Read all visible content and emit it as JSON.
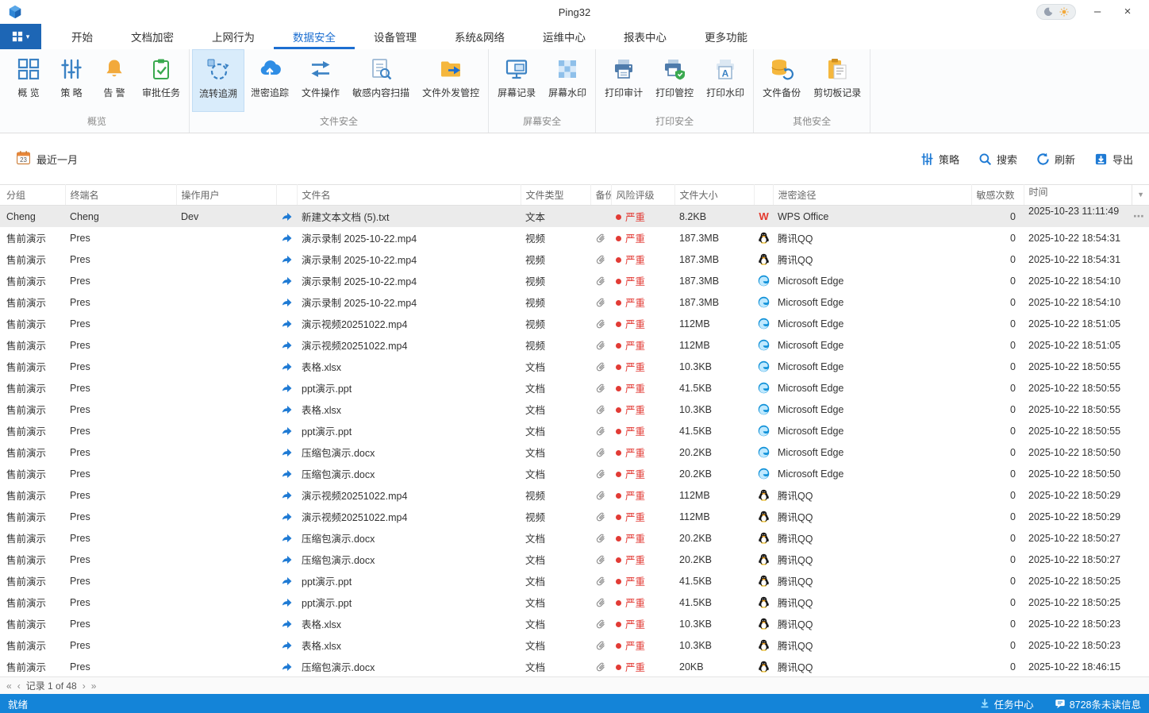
{
  "window": {
    "title": "Ping32",
    "controls": {
      "minimize": "–",
      "close": "×"
    }
  },
  "ribbon": {
    "tabs": [
      {
        "label": "开始"
      },
      {
        "label": "文档加密"
      },
      {
        "label": "上网行为"
      },
      {
        "label": "数据安全",
        "active": true
      },
      {
        "label": "设备管理"
      },
      {
        "label": "系统&网络"
      },
      {
        "label": "运维中心"
      },
      {
        "label": "报表中心"
      },
      {
        "label": "更多功能"
      }
    ],
    "groups": [
      {
        "label": "概览",
        "buttons": [
          {
            "label": "概 览"
          },
          {
            "label": "策 略"
          },
          {
            "label": "告 警"
          },
          {
            "label": "审批任务"
          }
        ]
      },
      {
        "label": "文件安全",
        "buttons": [
          {
            "label": "流转追溯",
            "selected": true
          },
          {
            "label": "泄密追踪"
          },
          {
            "label": "文件操作"
          },
          {
            "label": "敏感内容扫描"
          },
          {
            "label": "文件外发管控"
          }
        ]
      },
      {
        "label": "屏幕安全",
        "buttons": [
          {
            "label": "屏幕记录"
          },
          {
            "label": "屏幕水印"
          }
        ]
      },
      {
        "label": "打印安全",
        "buttons": [
          {
            "label": "打印审计"
          },
          {
            "label": "打印管控"
          },
          {
            "label": "打印水印"
          }
        ]
      },
      {
        "label": "其他安全",
        "buttons": [
          {
            "label": "文件备份"
          },
          {
            "label": "剪切板记录"
          }
        ]
      }
    ]
  },
  "toolbar": {
    "date_filter": "最近一月",
    "calendar_day": "23",
    "actions": [
      {
        "label": "策略"
      },
      {
        "label": "搜索"
      },
      {
        "label": "刷新"
      },
      {
        "label": "导出"
      }
    ]
  },
  "table": {
    "columns": [
      "分组",
      "终端名",
      "操作用户",
      "",
      "文件名",
      "文件类型",
      "备份",
      "风险评级",
      "文件大小",
      "",
      "泄密途径",
      "敏感次数",
      "时间"
    ],
    "rows": [
      {
        "group": "Cheng",
        "terminal": "Cheng",
        "user": "Dev",
        "file": "新建文本文档 (5).txt",
        "type": "文本",
        "attach": false,
        "risk": "严重",
        "size": "8.2KB",
        "channel": "WPS Office",
        "channel_icon": "wps",
        "count": "0",
        "time": "2025-10-23 11:11:49",
        "selected": true
      },
      {
        "group": "售前演示",
        "terminal": "Pres",
        "user": "",
        "file": "演示录制 2025-10-22.mp4",
        "type": "视频",
        "attach": true,
        "risk": "严重",
        "size": "187.3MB",
        "channel": "腾讯QQ",
        "channel_icon": "qq",
        "count": "0",
        "time": "2025-10-22 18:54:31"
      },
      {
        "group": "售前演示",
        "terminal": "Pres",
        "user": "",
        "file": "演示录制 2025-10-22.mp4",
        "type": "视频",
        "attach": true,
        "risk": "严重",
        "size": "187.3MB",
        "channel": "腾讯QQ",
        "channel_icon": "qq",
        "count": "0",
        "time": "2025-10-22 18:54:31"
      },
      {
        "group": "售前演示",
        "terminal": "Pres",
        "user": "",
        "file": "演示录制 2025-10-22.mp4",
        "type": "视频",
        "attach": true,
        "risk": "严重",
        "size": "187.3MB",
        "channel": "Microsoft Edge",
        "channel_icon": "edge",
        "count": "0",
        "time": "2025-10-22 18:54:10"
      },
      {
        "group": "售前演示",
        "terminal": "Pres",
        "user": "",
        "file": "演示录制 2025-10-22.mp4",
        "type": "视频",
        "attach": true,
        "risk": "严重",
        "size": "187.3MB",
        "channel": "Microsoft Edge",
        "channel_icon": "edge",
        "count": "0",
        "time": "2025-10-22 18:54:10"
      },
      {
        "group": "售前演示",
        "terminal": "Pres",
        "user": "",
        "file": "演示视频20251022.mp4",
        "type": "视频",
        "attach": true,
        "risk": "严重",
        "size": "112MB",
        "channel": "Microsoft Edge",
        "channel_icon": "edge",
        "count": "0",
        "time": "2025-10-22 18:51:05"
      },
      {
        "group": "售前演示",
        "terminal": "Pres",
        "user": "",
        "file": "演示视频20251022.mp4",
        "type": "视频",
        "attach": true,
        "risk": "严重",
        "size": "112MB",
        "channel": "Microsoft Edge",
        "channel_icon": "edge",
        "count": "0",
        "time": "2025-10-22 18:51:05"
      },
      {
        "group": "售前演示",
        "terminal": "Pres",
        "user": "",
        "file": "表格.xlsx",
        "type": "文档",
        "attach": true,
        "risk": "严重",
        "size": "10.3KB",
        "channel": "Microsoft Edge",
        "channel_icon": "edge",
        "count": "0",
        "time": "2025-10-22 18:50:55"
      },
      {
        "group": "售前演示",
        "terminal": "Pres",
        "user": "",
        "file": "ppt演示.ppt",
        "type": "文档",
        "attach": true,
        "risk": "严重",
        "size": "41.5KB",
        "channel": "Microsoft Edge",
        "channel_icon": "edge",
        "count": "0",
        "time": "2025-10-22 18:50:55"
      },
      {
        "group": "售前演示",
        "terminal": "Pres",
        "user": "",
        "file": "表格.xlsx",
        "type": "文档",
        "attach": true,
        "risk": "严重",
        "size": "10.3KB",
        "channel": "Microsoft Edge",
        "channel_icon": "edge",
        "count": "0",
        "time": "2025-10-22 18:50:55"
      },
      {
        "group": "售前演示",
        "terminal": "Pres",
        "user": "",
        "file": "ppt演示.ppt",
        "type": "文档",
        "attach": true,
        "risk": "严重",
        "size": "41.5KB",
        "channel": "Microsoft Edge",
        "channel_icon": "edge",
        "count": "0",
        "time": "2025-10-22 18:50:55"
      },
      {
        "group": "售前演示",
        "terminal": "Pres",
        "user": "",
        "file": "压缩包演示.docx",
        "type": "文档",
        "attach": true,
        "risk": "严重",
        "size": "20.2KB",
        "channel": "Microsoft Edge",
        "channel_icon": "edge",
        "count": "0",
        "time": "2025-10-22 18:50:50"
      },
      {
        "group": "售前演示",
        "terminal": "Pres",
        "user": "",
        "file": "压缩包演示.docx",
        "type": "文档",
        "attach": true,
        "risk": "严重",
        "size": "20.2KB",
        "channel": "Microsoft Edge",
        "channel_icon": "edge",
        "count": "0",
        "time": "2025-10-22 18:50:50"
      },
      {
        "group": "售前演示",
        "terminal": "Pres",
        "user": "",
        "file": "演示视频20251022.mp4",
        "type": "视频",
        "attach": true,
        "risk": "严重",
        "size": "112MB",
        "channel": "腾讯QQ",
        "channel_icon": "qq",
        "count": "0",
        "time": "2025-10-22 18:50:29"
      },
      {
        "group": "售前演示",
        "terminal": "Pres",
        "user": "",
        "file": "演示视频20251022.mp4",
        "type": "视频",
        "attach": true,
        "risk": "严重",
        "size": "112MB",
        "channel": "腾讯QQ",
        "channel_icon": "qq",
        "count": "0",
        "time": "2025-10-22 18:50:29"
      },
      {
        "group": "售前演示",
        "terminal": "Pres",
        "user": "",
        "file": "压缩包演示.docx",
        "type": "文档",
        "attach": true,
        "risk": "严重",
        "size": "20.2KB",
        "channel": "腾讯QQ",
        "channel_icon": "qq",
        "count": "0",
        "time": "2025-10-22 18:50:27"
      },
      {
        "group": "售前演示",
        "terminal": "Pres",
        "user": "",
        "file": "压缩包演示.docx",
        "type": "文档",
        "attach": true,
        "risk": "严重",
        "size": "20.2KB",
        "channel": "腾讯QQ",
        "channel_icon": "qq",
        "count": "0",
        "time": "2025-10-22 18:50:27"
      },
      {
        "group": "售前演示",
        "terminal": "Pres",
        "user": "",
        "file": "ppt演示.ppt",
        "type": "文档",
        "attach": true,
        "risk": "严重",
        "size": "41.5KB",
        "channel": "腾讯QQ",
        "channel_icon": "qq",
        "count": "0",
        "time": "2025-10-22 18:50:25"
      },
      {
        "group": "售前演示",
        "terminal": "Pres",
        "user": "",
        "file": "ppt演示.ppt",
        "type": "文档",
        "attach": true,
        "risk": "严重",
        "size": "41.5KB",
        "channel": "腾讯QQ",
        "channel_icon": "qq",
        "count": "0",
        "time": "2025-10-22 18:50:25"
      },
      {
        "group": "售前演示",
        "terminal": "Pres",
        "user": "",
        "file": "表格.xlsx",
        "type": "文档",
        "attach": true,
        "risk": "严重",
        "size": "10.3KB",
        "channel": "腾讯QQ",
        "channel_icon": "qq",
        "count": "0",
        "time": "2025-10-22 18:50:23"
      },
      {
        "group": "售前演示",
        "terminal": "Pres",
        "user": "",
        "file": "表格.xlsx",
        "type": "文档",
        "attach": true,
        "risk": "严重",
        "size": "10.3KB",
        "channel": "腾讯QQ",
        "channel_icon": "qq",
        "count": "0",
        "time": "2025-10-22 18:50:23"
      },
      {
        "group": "售前演示",
        "terminal": "Pres",
        "user": "",
        "file": "压缩包演示.docx",
        "type": "文档",
        "attach": true,
        "risk": "严重",
        "size": "20KB",
        "channel": "腾讯QQ",
        "channel_icon": "qq",
        "count": "0",
        "time": "2025-10-22 18:46:15"
      }
    ]
  },
  "pagination": {
    "label": "记录 1 of 48"
  },
  "statusbar": {
    "ready": "就绪",
    "task_center": "任务中心",
    "unread": "8728条未读信息"
  },
  "colors": {
    "accent": "#1d6fd1",
    "status_bar": "#1484d8",
    "risk": "#e23b35"
  }
}
